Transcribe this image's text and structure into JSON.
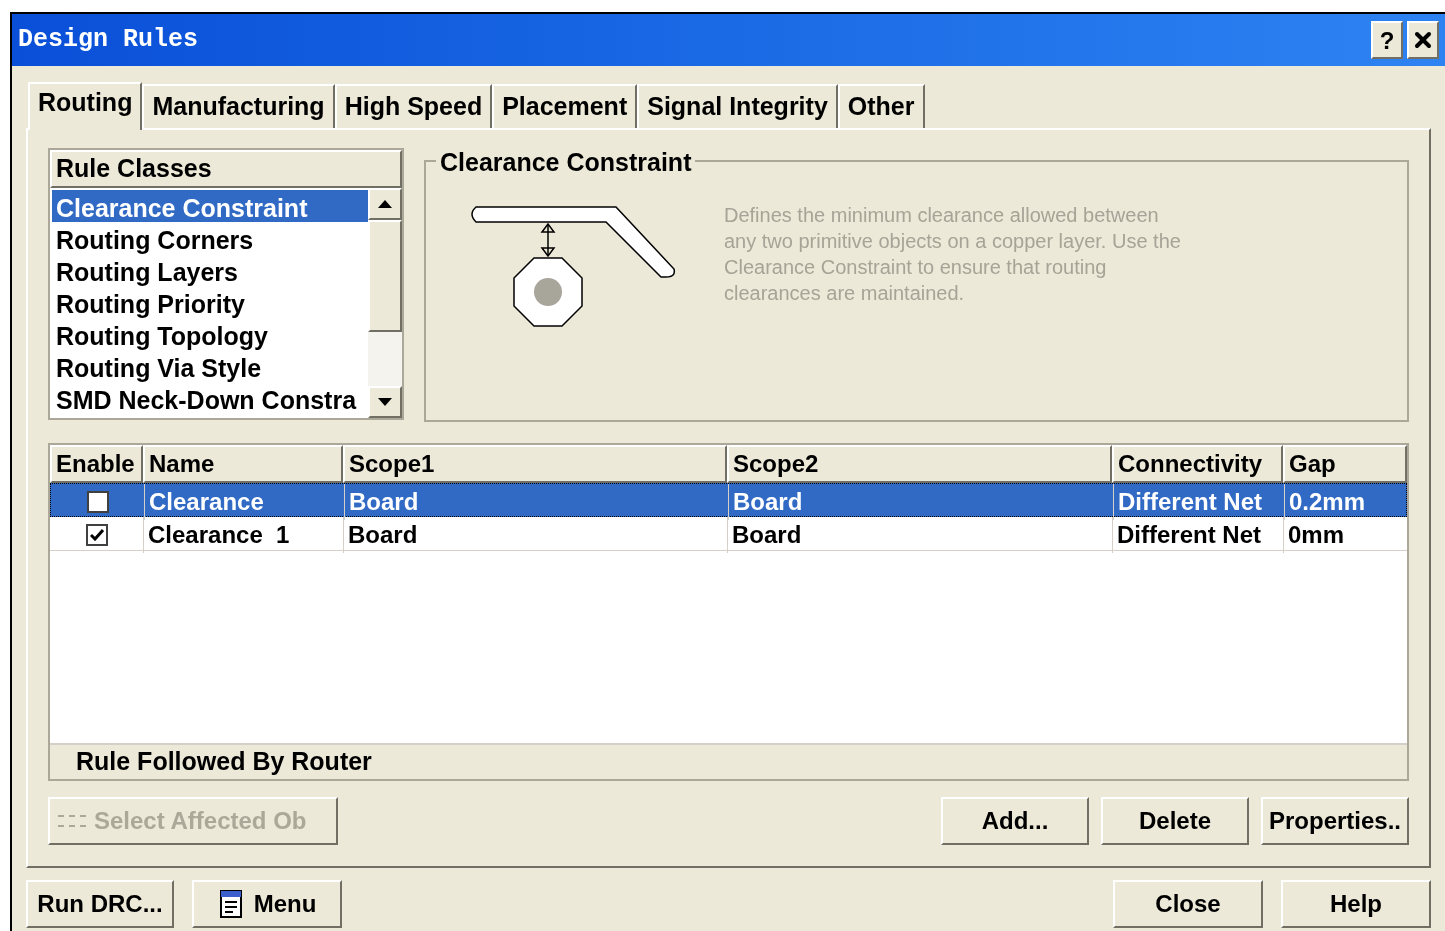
{
  "window": {
    "title": "Design Rules",
    "help_button": "?"
  },
  "tabs": [
    {
      "label": "Routing",
      "selected": true
    },
    {
      "label": "Manufacturing",
      "selected": false
    },
    {
      "label": "High Speed",
      "selected": false
    },
    {
      "label": "Placement",
      "selected": false
    },
    {
      "label": "Signal Integrity",
      "selected": false
    },
    {
      "label": "Other",
      "selected": false
    }
  ],
  "rule_classes": {
    "header": "Rule Classes",
    "items": [
      {
        "label": "Clearance Constraint",
        "selected": true
      },
      {
        "label": "Routing Corners",
        "selected": false
      },
      {
        "label": "Routing Layers",
        "selected": false
      },
      {
        "label": "Routing Priority",
        "selected": false
      },
      {
        "label": "Routing Topology",
        "selected": false
      },
      {
        "label": "Routing Via Style",
        "selected": false
      },
      {
        "label": "SMD Neck-Down Constra",
        "selected": false
      }
    ]
  },
  "constraint_group": {
    "title": "Clearance Constraint",
    "description": "Defines the minimum clearance allowed between any two primitive objects on a copper layer. Use the Clearance Constraint to ensure that routing clearances are maintained."
  },
  "table": {
    "enable_column": "Enable",
    "columns": [
      "Name",
      "Scope1",
      "Scope2",
      "Connectivity",
      "Gap"
    ],
    "rows": [
      {
        "enabled": false,
        "selected": true,
        "cells": [
          "Clearance",
          "Board",
          "Board",
          "Different Net",
          "0.2mm"
        ]
      },
      {
        "enabled": true,
        "selected": false,
        "cells": [
          "Clearance  1",
          "Board",
          "Board",
          "Different Net",
          "0mm"
        ]
      }
    ],
    "footer": "Rule Followed By Router"
  },
  "rule_buttons": [
    {
      "label": "Select Affected Ob",
      "disabled": true,
      "kind": "select"
    },
    {
      "label": "Add...",
      "disabled": false,
      "kind": "plain"
    },
    {
      "label": "Delete",
      "disabled": false,
      "kind": "plain"
    },
    {
      "label": "Properties..",
      "disabled": false,
      "kind": "plain"
    }
  ],
  "bottom_buttons": [
    {
      "label": "Run DRC...",
      "kind": "plain"
    },
    {
      "label": "Menu",
      "kind": "menu"
    },
    {
      "label": "Close",
      "kind": "plain"
    },
    {
      "label": "Help",
      "kind": "plain"
    }
  ]
}
